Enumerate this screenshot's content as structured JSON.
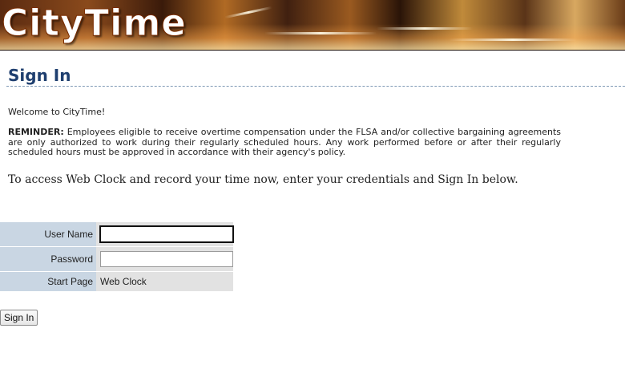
{
  "banner": {
    "logo_text": "CityTime"
  },
  "page": {
    "title": "Sign In",
    "welcome": "Welcome to CityTime!",
    "reminder_label": "REMINDER:",
    "reminder_text": "Employees eligible to receive overtime compensation under the FLSA and/or collective bargaining agreements are only authorized to work during their regularly scheduled hours. Any work performed before or after their regularly scheduled hours must be approved in accordance with their agency's policy.",
    "access_text": "To access Web Clock and record your time now, enter your credentials and Sign In below."
  },
  "form": {
    "username_label": "User Name",
    "username_value": "",
    "password_label": "Password",
    "password_value": "",
    "start_page_label": "Start Page",
    "start_page_value": "Web Clock",
    "submit_label": "Sign In"
  },
  "colors": {
    "title": "#1f3f6f",
    "label_cell": "#c9d6e3",
    "value_cell": "#e2e2e2"
  }
}
